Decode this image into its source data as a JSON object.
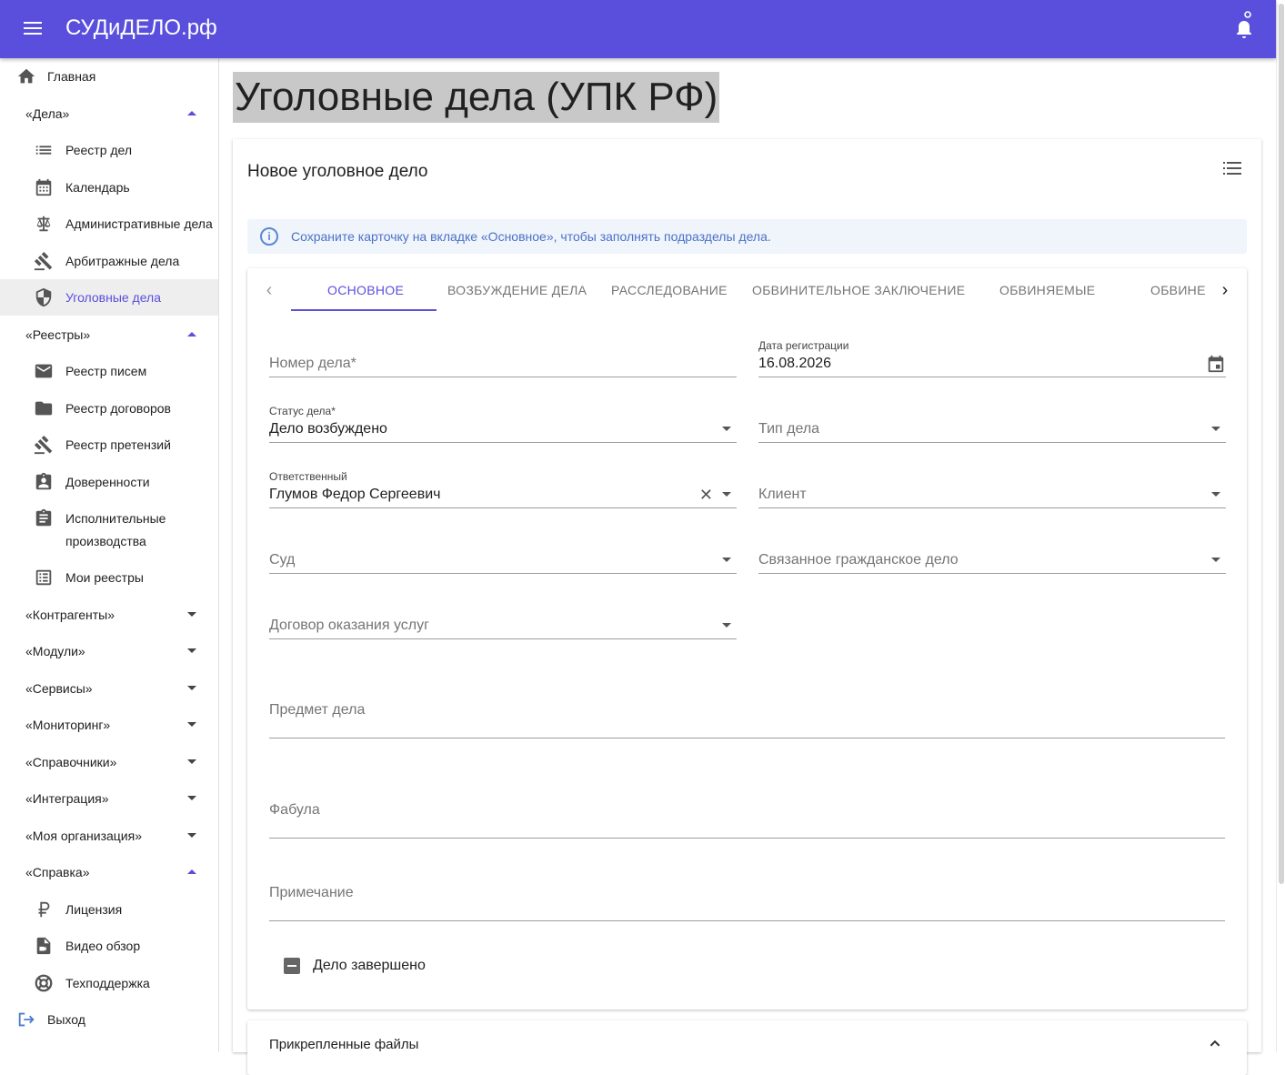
{
  "app": {
    "brand": "СУДиДЕЛО.рф"
  },
  "sidebar": {
    "items": [
      {
        "label": "Главная",
        "icon": "home-icon",
        "kind": "top"
      },
      {
        "label": "«Дела»",
        "kind": "group",
        "expanded": true
      },
      {
        "label": "Реестр дел",
        "icon": "list-icon",
        "kind": "sub"
      },
      {
        "label": "Календарь",
        "icon": "calendar-icon",
        "kind": "sub"
      },
      {
        "label": "Административные дела",
        "icon": "scales-icon",
        "kind": "sub"
      },
      {
        "label": "Арбитражные дела",
        "icon": "gavel-icon",
        "kind": "sub"
      },
      {
        "label": "Уголовные дела",
        "icon": "shield-icon",
        "kind": "sub",
        "active": true
      },
      {
        "label": "«Реестры»",
        "kind": "group",
        "expanded": true
      },
      {
        "label": "Реестр писем",
        "icon": "mail-icon",
        "kind": "sub"
      },
      {
        "label": "Реестр договоров",
        "icon": "folder-icon",
        "kind": "sub"
      },
      {
        "label": "Реестр претензий",
        "icon": "gavel-icon",
        "kind": "sub"
      },
      {
        "label": "Доверенности",
        "icon": "badge-icon",
        "kind": "sub"
      },
      {
        "label": "Исполнительные",
        "label2": "производства",
        "icon": "clipboard-icon",
        "kind": "sub"
      },
      {
        "label": "Мои реестры",
        "icon": "checklist-icon",
        "kind": "sub"
      },
      {
        "label": "«Контрагенты»",
        "kind": "group",
        "expanded": false
      },
      {
        "label": "«Модули»",
        "kind": "group",
        "expanded": false
      },
      {
        "label": "«Сервисы»",
        "kind": "group",
        "expanded": false
      },
      {
        "label": "«Мониторинг»",
        "kind": "group",
        "expanded": false
      },
      {
        "label": "«Справочники»",
        "kind": "group",
        "expanded": false
      },
      {
        "label": "«Интеграция»",
        "kind": "group",
        "expanded": false
      },
      {
        "label": "«Моя организация»",
        "kind": "group",
        "expanded": false
      },
      {
        "label": "«Справка»",
        "kind": "group",
        "expanded": true
      },
      {
        "label": "Лицензия",
        "icon": "ruble-icon",
        "kind": "sub"
      },
      {
        "label": "Видео обзор",
        "icon": "video-file-icon",
        "kind": "sub"
      },
      {
        "label": "Техподдержка",
        "icon": "lifebuoy-icon",
        "kind": "sub"
      },
      {
        "label": "Выход",
        "icon": "logout-icon",
        "kind": "top"
      }
    ]
  },
  "page": {
    "title": "Уголовные дела (УПК РФ)"
  },
  "card": {
    "title": "Новое уголовное дело",
    "alert": "Сохраните карточку на вкладке «Основное», чтобы заполнять подразделы дела.",
    "tabs": [
      "ОСНОВНОЕ",
      "ВОЗБУЖДЕНИЕ ДЕЛА",
      "РАССЛЕДОВАНИЕ",
      "ОБВИНИТЕЛЬНОЕ ЗАКЛЮЧЕНИЕ",
      "ОБВИНЯЕМЫЕ",
      "ОБВИНЕ"
    ],
    "form": {
      "case_number": {
        "placeholder": "Номер дела*"
      },
      "reg_date": {
        "label": "Дата регистрации",
        "value": "16.08.2026"
      },
      "status": {
        "label": "Статус дела*",
        "value": "Дело возбуждено"
      },
      "case_type": {
        "placeholder": "Тип дела"
      },
      "responsible": {
        "label": "Ответственный",
        "value": "Глумов Федор Сергеевич"
      },
      "client": {
        "placeholder": "Клиент"
      },
      "court": {
        "placeholder": "Суд"
      },
      "civil_case": {
        "placeholder": "Связанное гражданское дело"
      },
      "contract": {
        "placeholder": "Договор оказания услуг"
      },
      "subject": {
        "placeholder": "Предмет дела"
      },
      "fabula": {
        "placeholder": "Фабула"
      },
      "note": {
        "placeholder": "Примечание"
      },
      "completed": {
        "label": "Дело завершено"
      }
    },
    "files": {
      "title": "Прикрепленные файлы"
    }
  },
  "colors": {
    "primary": "#5a4fdc",
    "info": "#4a72c8"
  }
}
